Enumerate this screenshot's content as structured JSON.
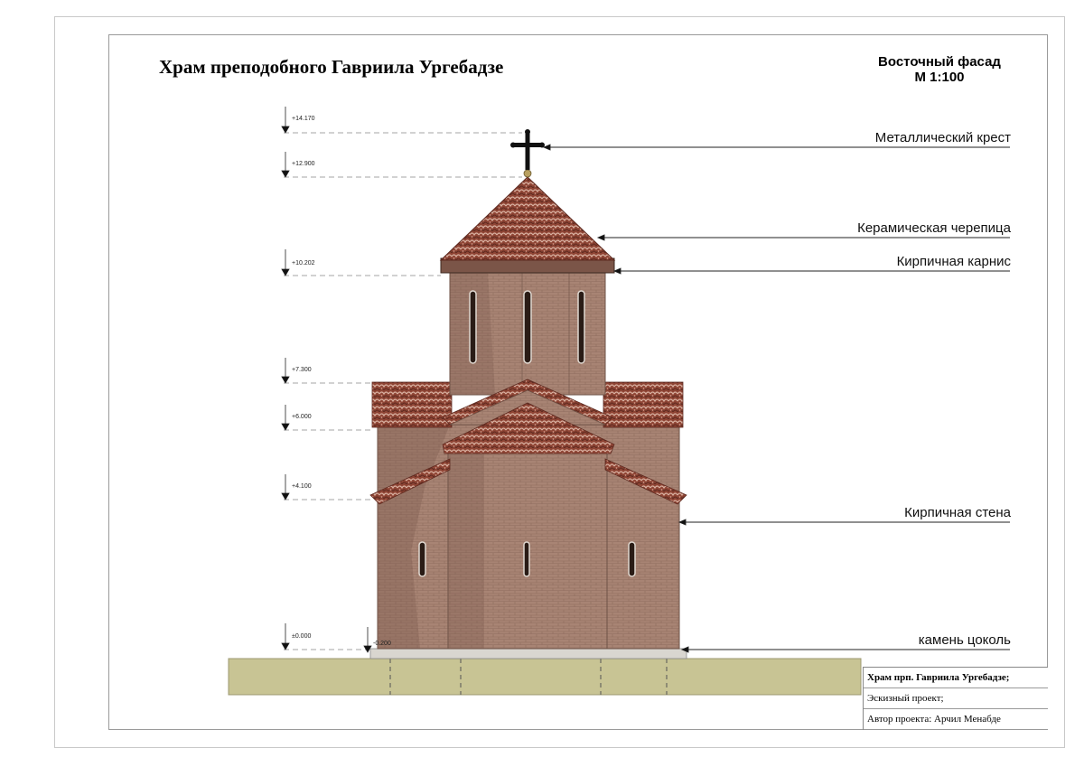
{
  "header": {
    "title": "Храм преподобного Гавриила Ургебадзе",
    "sheet_name_line1": "Восточный фасад",
    "sheet_name_line2": "М 1:100"
  },
  "levels": [
    {
      "label": "+14.170"
    },
    {
      "label": "+12.900"
    },
    {
      "label": "+10.202"
    },
    {
      "label": "+7.300"
    },
    {
      "label": "+6.000"
    },
    {
      "label": "+4.100"
    },
    {
      "label": "±0.000"
    },
    {
      "label": "-0.200"
    }
  ],
  "callouts": [
    {
      "text": "Металлический крест"
    },
    {
      "text": "Керамическая черепица"
    },
    {
      "text": "Кирпичная  карнис"
    },
    {
      "text": "Кирпичная стена"
    },
    {
      "text": "камень цоколь"
    }
  ],
  "stamp": {
    "project": "Храм прп. Гавриила Ургебадзе;",
    "stage": "Эскизный проект;",
    "author": "Автор проекта: Арчил Менабде"
  },
  "colors": {
    "brick": "#a88474",
    "brick_dark": "#8a6658",
    "roof_tile": "#9c4a38",
    "ground": "#c8c494",
    "cross": "#111111"
  }
}
